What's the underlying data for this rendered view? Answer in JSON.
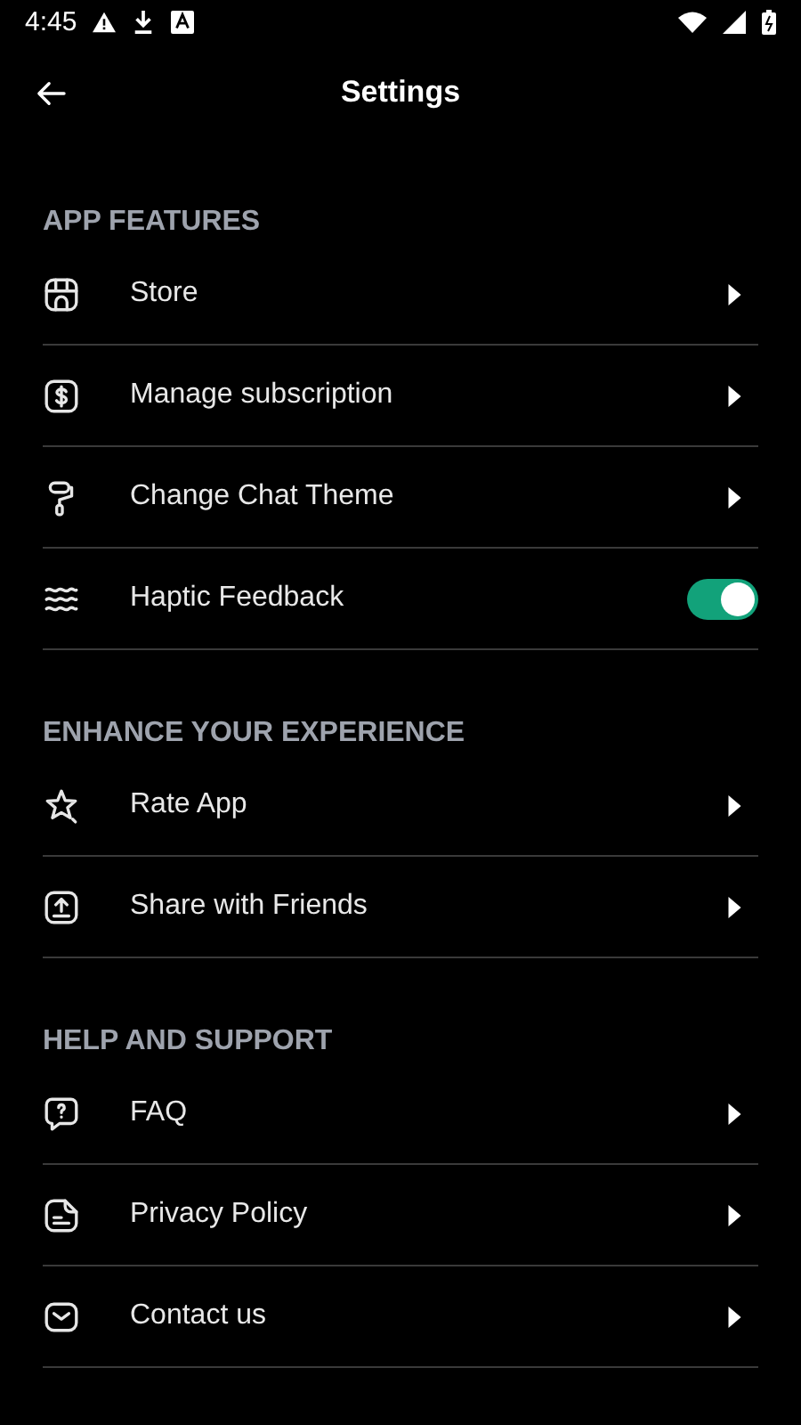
{
  "status_bar": {
    "time": "4:45"
  },
  "header": {
    "title": "Settings"
  },
  "sections": [
    {
      "title": "APP FEATURES",
      "items": [
        {
          "label": "Store",
          "kind": "link"
        },
        {
          "label": "Manage subscription",
          "kind": "link"
        },
        {
          "label": "Change Chat Theme",
          "kind": "link"
        },
        {
          "label": "Haptic Feedback",
          "kind": "toggle",
          "on": true
        }
      ]
    },
    {
      "title": "ENHANCE YOUR EXPERIENCE",
      "items": [
        {
          "label": "Rate App",
          "kind": "link"
        },
        {
          "label": "Share with Friends",
          "kind": "link"
        }
      ]
    },
    {
      "title": "HELP AND SUPPORT",
      "items": [
        {
          "label": "FAQ",
          "kind": "link"
        },
        {
          "label": "Privacy Policy",
          "kind": "link"
        },
        {
          "label": "Contact us",
          "kind": "link"
        }
      ]
    }
  ]
}
